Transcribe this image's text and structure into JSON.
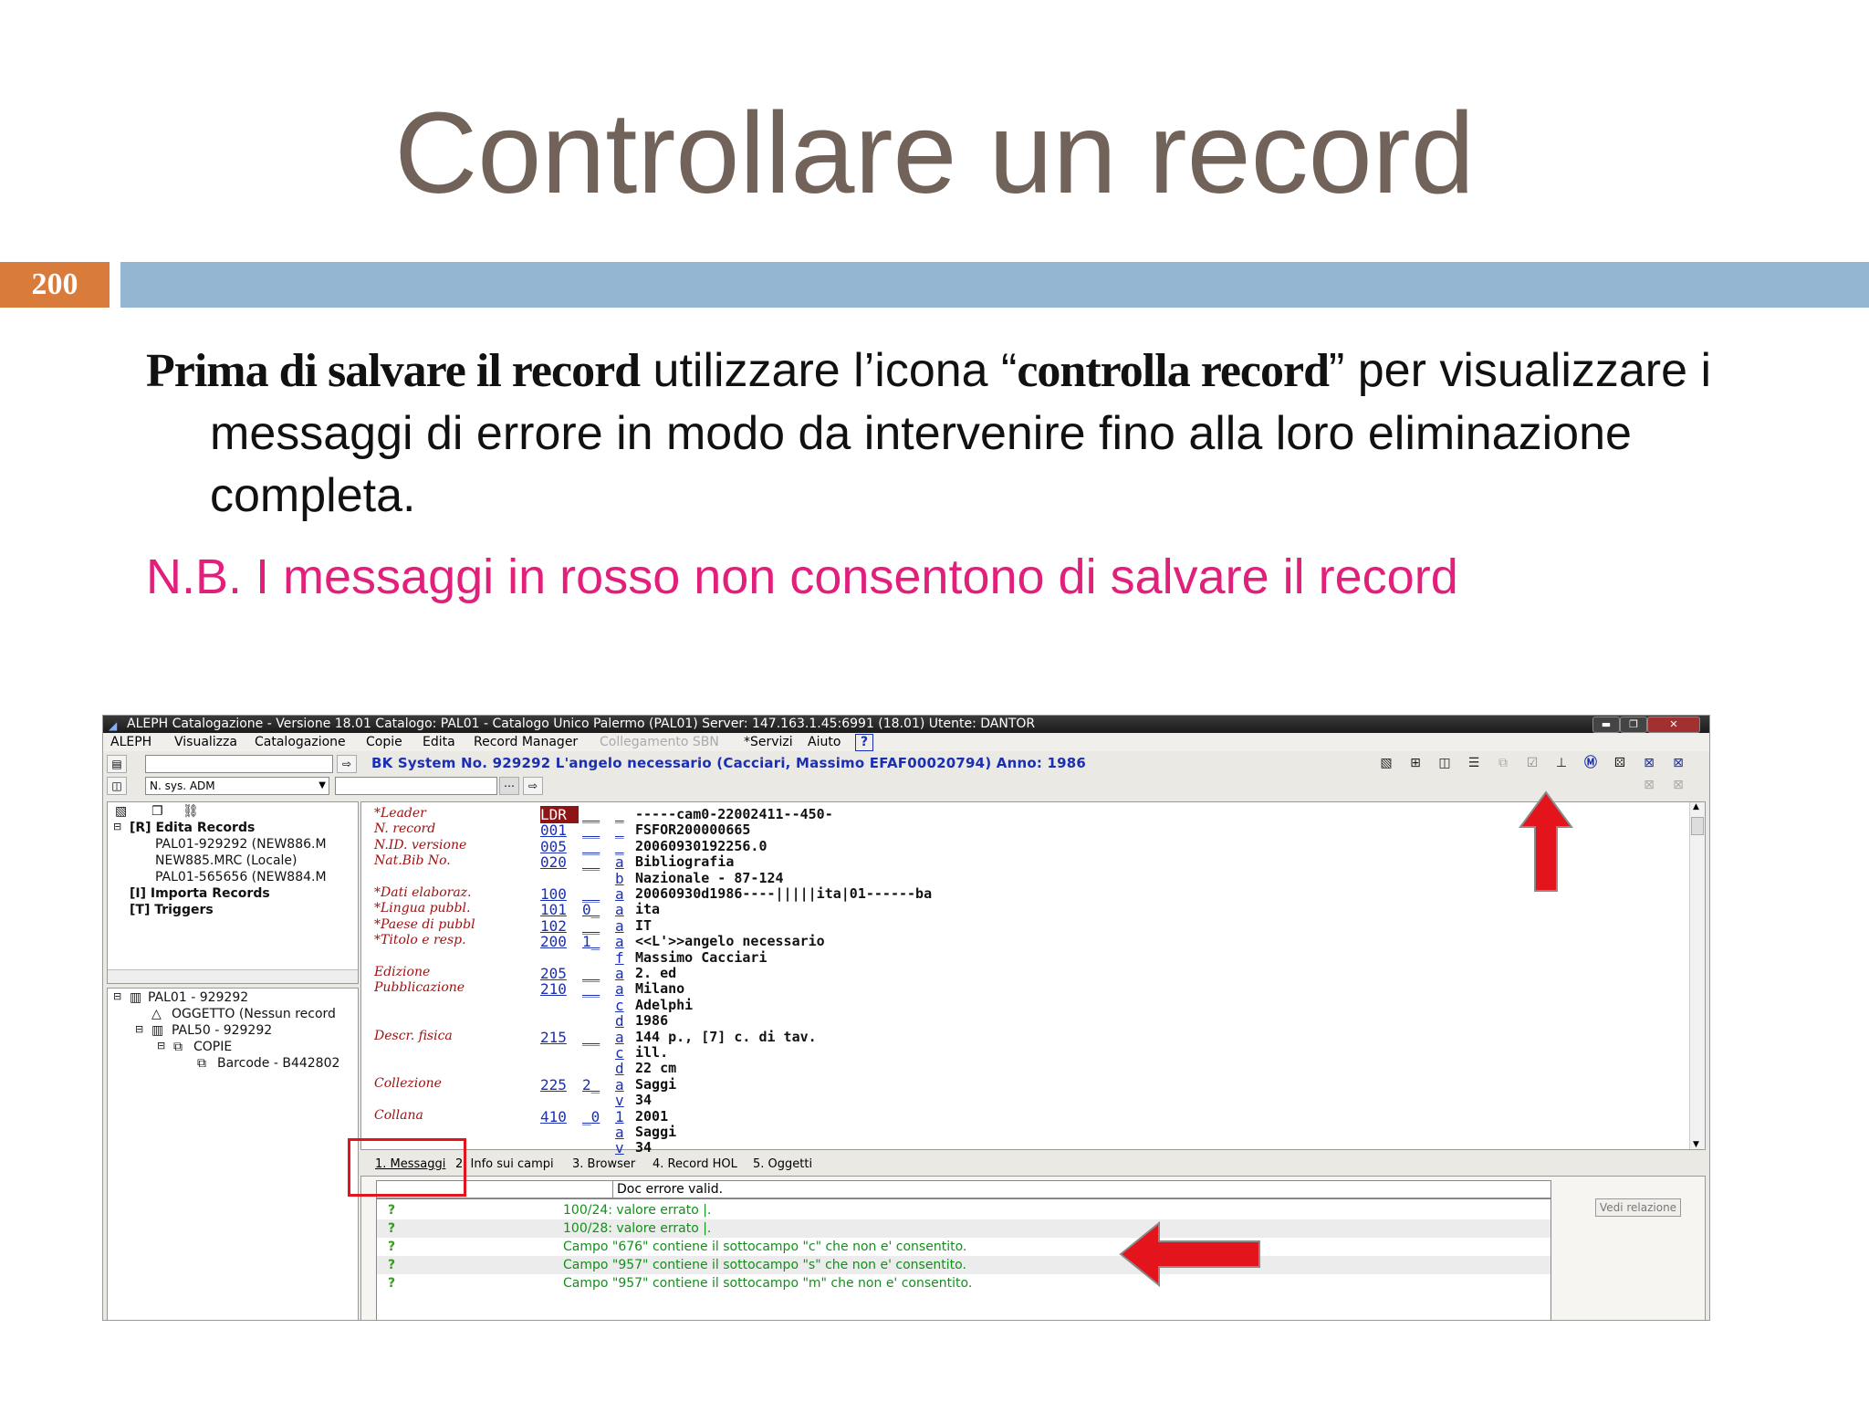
{
  "slide": {
    "title": "Controllare un record",
    "page_number": "200",
    "para_bold1": "Prima di salvare il record",
    "para_mid": " utilizzare l’icona “",
    "para_bold2": "controlla record",
    "para_end": "” per visualizzare i messaggi di errore in modo da intervenire fino alla loro eliminazione completa.",
    "nb": "N.B. I messaggi in rosso non consentono di salvare il record"
  },
  "app": {
    "window_title": "ALEPH Catalogazione - Versione 18.01  Catalogo: PAL01 - Catalogo Unico Palermo (PAL01)  Server: 147.163.1.45:6991 (18.01)  Utente: DANTOR",
    "menu": [
      "ALEPH",
      "Visualizza",
      "Catalogazione",
      "Copie",
      "Edita",
      "Record Manager",
      "Collegamento SBN",
      "*Servizi",
      "Aiuto"
    ],
    "sysno_text": "BK System No. 929292 L'angelo necessario (Cacciari, Massimo EFAF00020794) Anno: 1986",
    "search_select": "N. sys. ADM",
    "tree1": {
      "root": "[R] Edita Records",
      "items": [
        "PAL01-929292 (NEW886.M",
        "NEW885.MRC (Locale)",
        "PAL01-565656 (NEW884.M"
      ],
      "import": "[I] Importa Records",
      "triggers": "[T] Triggers"
    },
    "tree2": {
      "root": "PAL01 - 929292",
      "oggetto": "OGGETTO (Nessun record",
      "pal50": "PAL50 - 929292",
      "copie": "COPIE",
      "barcode": "Barcode - B442802"
    },
    "record_rows": [
      {
        "label": "*Leader",
        "tag": "LDR",
        "ind": "__",
        "sub": "_",
        "value": "-----cam0-22002411--450-"
      },
      {
        "label": "N. record",
        "tag": "001",
        "ind": "__",
        "sub": "_",
        "value": "FSFOR200000665"
      },
      {
        "label": "N.ID. versione",
        "tag": "005",
        "ind": "__",
        "sub": "_",
        "value": "20060930192256.0"
      },
      {
        "label": "Nat.Bib No.",
        "tag": "020",
        "ind": "__",
        "sub": "a",
        "value": "Bibliografia"
      },
      {
        "label": "",
        "tag": "",
        "ind": "",
        "sub": "b",
        "value": "Nazionale - 87-124"
      },
      {
        "label": "*Dati elaboraz.",
        "tag": "100",
        "ind": "__",
        "sub": "a",
        "value": "20060930d1986----|||||ita|01------ba"
      },
      {
        "label": "*Lingua pubbl.",
        "tag": "101",
        "ind": "0_",
        "sub": "a",
        "value": "ita"
      },
      {
        "label": "*Paese di pubbl",
        "tag": "102",
        "ind": "__",
        "sub": "a",
        "value": "IT"
      },
      {
        "label": "*Titolo e resp.",
        "tag": "200",
        "ind": "1_",
        "sub": "a",
        "value": "<<L'>>angelo necessario"
      },
      {
        "label": "",
        "tag": "",
        "ind": "",
        "sub": "f",
        "value": "Massimo Cacciari"
      },
      {
        "label": "Edizione",
        "tag": "205",
        "ind": "__",
        "sub": "a",
        "value": "2. ed"
      },
      {
        "label": "Pubblicazione",
        "tag": "210",
        "ind": "__",
        "sub": "a",
        "value": "Milano"
      },
      {
        "label": "",
        "tag": "",
        "ind": "",
        "sub": "c",
        "value": "Adelphi"
      },
      {
        "label": "",
        "tag": "",
        "ind": "",
        "sub": "d",
        "value": "1986"
      },
      {
        "label": "Descr. fisica",
        "tag": "215",
        "ind": "__",
        "sub": "a",
        "value": "144 p., [7] c. di tav."
      },
      {
        "label": "",
        "tag": "",
        "ind": "",
        "sub": "c",
        "value": "ill."
      },
      {
        "label": "",
        "tag": "",
        "ind": "",
        "sub": "d",
        "value": "22 cm"
      },
      {
        "label": "Collezione",
        "tag": "225",
        "ind": "2_",
        "sub": "a",
        "value": "Saggi"
      },
      {
        "label": "",
        "tag": "",
        "ind": "",
        "sub": "v",
        "value": "34"
      },
      {
        "label": "Collana",
        "tag": "410",
        "ind": "_0",
        "sub": "1",
        "value": "2001"
      },
      {
        "label": "",
        "tag": "",
        "ind": "",
        "sub": "a",
        "value": "Saggi"
      },
      {
        "label": "",
        "tag": "",
        "ind": "",
        "sub": "v",
        "value": "34"
      }
    ],
    "tabs": [
      "1. Messaggi",
      "2. Info sui campi",
      "3. Browser",
      "4. Record HOL",
      "5. Oggetti"
    ],
    "msg_header": "Doc errore valid.",
    "messages": [
      "100/24: valore errato |.",
      "100/28: valore errato |.",
      "Campo \"676\" contiene il sottocampo \"c\" che non e' consentito.",
      "Campo \"957\" contiene il sottocampo \"s\" che non e' consentito.",
      "Campo \"957\" contiene il sottocampo \"m\" che non e' consentito."
    ],
    "vedi_relazione": "Vedi relazione"
  },
  "colors": {
    "title": "#72635a",
    "badge": "#d97b3a",
    "bar": "#94b6d2",
    "nb": "#e0207a",
    "annotation_red": "#e3141b"
  }
}
